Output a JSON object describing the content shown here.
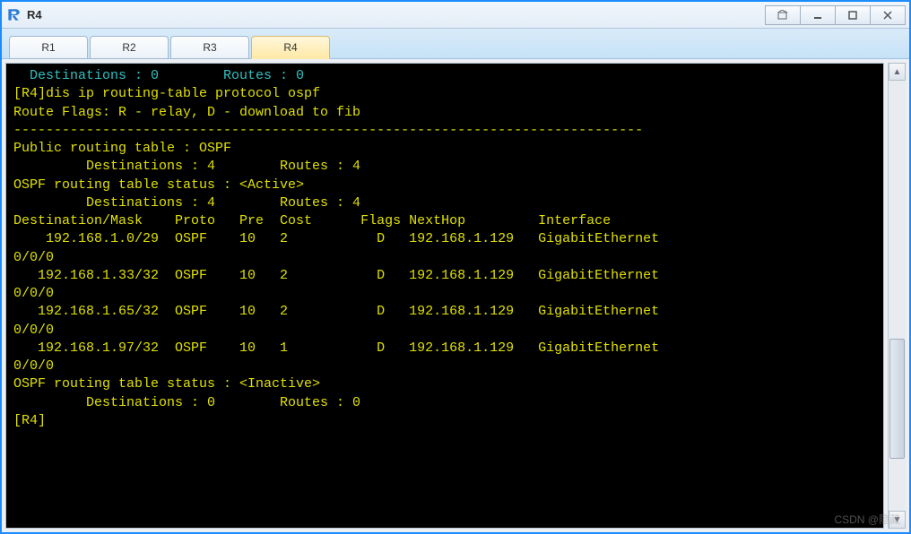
{
  "window": {
    "title": "R4"
  },
  "tabs": [
    {
      "label": "R1",
      "active": false
    },
    {
      "label": "R2",
      "active": false
    },
    {
      "label": "R3",
      "active": false
    },
    {
      "label": "R4",
      "active": true
    }
  ],
  "terminal": {
    "lines": [
      {
        "style": "cyan",
        "text": "  Destinations : 0        Routes : 0"
      },
      {
        "style": "yellow",
        "text": ""
      },
      {
        "style": "yellow",
        "text": "[R4]dis ip routing-table protocol ospf"
      },
      {
        "style": "yellow",
        "text": "Route Flags: R - relay, D - download to fib"
      },
      {
        "style": "yellow",
        "text": "------------------------------------------------------------------------------"
      },
      {
        "style": "yellow",
        "text": "Public routing table : OSPF"
      },
      {
        "style": "yellow",
        "text": "         Destinations : 4        Routes : 4"
      },
      {
        "style": "yellow",
        "text": ""
      },
      {
        "style": "yellow",
        "text": "OSPF routing table status : <Active>"
      },
      {
        "style": "yellow",
        "text": "         Destinations : 4        Routes : 4"
      },
      {
        "style": "yellow",
        "text": ""
      },
      {
        "style": "yellow",
        "text": "Destination/Mask    Proto   Pre  Cost      Flags NextHop         Interface"
      },
      {
        "style": "yellow",
        "text": ""
      },
      {
        "style": "yellow",
        "text": "    192.168.1.0/29  OSPF    10   2           D   192.168.1.129   GigabitEthernet"
      },
      {
        "style": "yellow",
        "text": "0/0/0"
      },
      {
        "style": "yellow",
        "text": "   192.168.1.33/32  OSPF    10   2           D   192.168.1.129   GigabitEthernet"
      },
      {
        "style": "yellow",
        "text": "0/0/0"
      },
      {
        "style": "yellow",
        "text": "   192.168.1.65/32  OSPF    10   2           D   192.168.1.129   GigabitEthernet"
      },
      {
        "style": "yellow",
        "text": "0/0/0"
      },
      {
        "style": "yellow",
        "text": "   192.168.1.97/32  OSPF    10   1           D   192.168.1.129   GigabitEthernet"
      },
      {
        "style": "yellow",
        "text": "0/0/0"
      },
      {
        "style": "yellow",
        "text": ""
      },
      {
        "style": "yellow",
        "text": "OSPF routing table status : <Inactive>"
      },
      {
        "style": "yellow",
        "text": "         Destinations : 0        Routes : 0"
      },
      {
        "style": "yellow",
        "text": ""
      },
      {
        "style": "yellow",
        "text": "[R4]"
      }
    ]
  },
  "watermark": "CSDN @隐藏"
}
